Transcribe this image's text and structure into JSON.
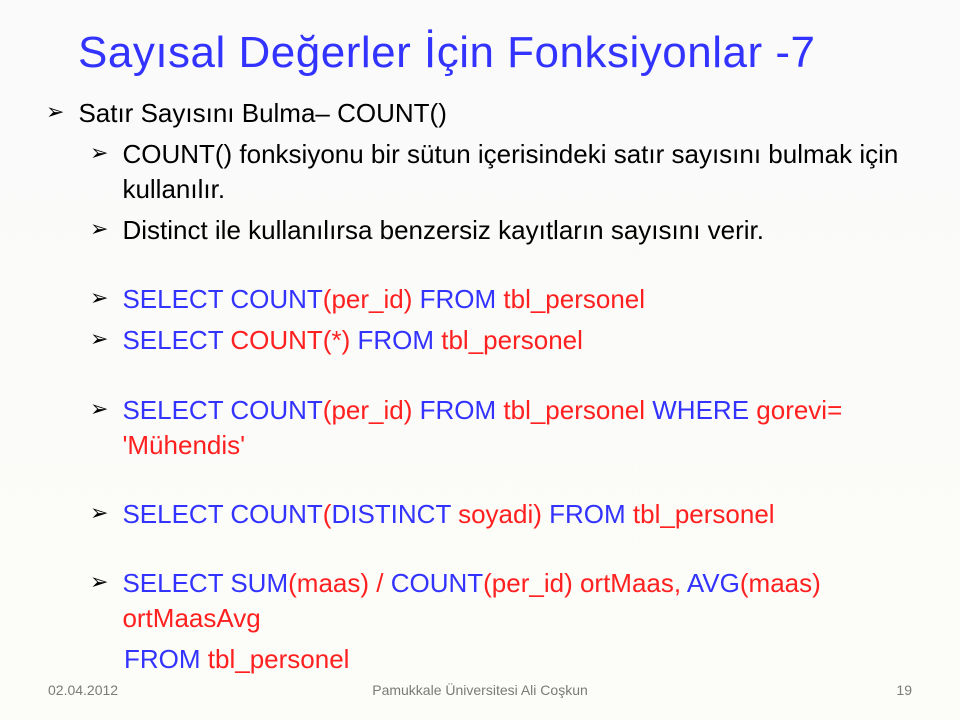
{
  "title": "Sayısal Değerler İçin Fonksiyonlar -7",
  "bullets": {
    "b1": "Satır Sayısını Bulma– COUNT()",
    "b2": "COUNT() fonksiyonu bir sütun içerisindeki satır sayısını bulmak için kullanılır.",
    "b3": "Distinct ile kullanılırsa benzersiz kayıtların sayısını verir."
  },
  "sql": {
    "s1_a": "SELECT COUNT",
    "s1_b": "(per_id) ",
    "s1_c": "FROM",
    "s1_d": " tbl_personel",
    "s2_a": "SELECT",
    "s2_b": " COUNT",
    "s2_c": "(*) ",
    "s2_d": "FROM",
    "s2_e": " tbl_personel",
    "s3_a": "SELECT COUNT",
    "s3_b": "(per_id) ",
    "s3_c": "FROM",
    "s3_d": " tbl_personel ",
    "s3_e": "WHERE",
    "s3_f": " gorevi= 'Mühendis'",
    "s4_a": "SELECT COUNT",
    "s4_b": "(",
    "s4_c": "DISTINCT",
    "s4_d": " soyadi) ",
    "s4_e": "FROM",
    "s4_f": " tbl_personel",
    "s5_a": "SELECT SUM",
    "s5_b": "(maas) / ",
    "s5_c": "COUNT",
    "s5_d": "(per_id) ortMaas, ",
    "s5_e": "AVG",
    "s5_f": "(maas) ortMaasAvg",
    "s5g_a": "FROM",
    "s5g_b": " tbl_personel"
  },
  "footer": {
    "date": "02.04.2012",
    "center": "Pamukkale Üniversitesi  Ali Coşkun",
    "page": "19"
  }
}
